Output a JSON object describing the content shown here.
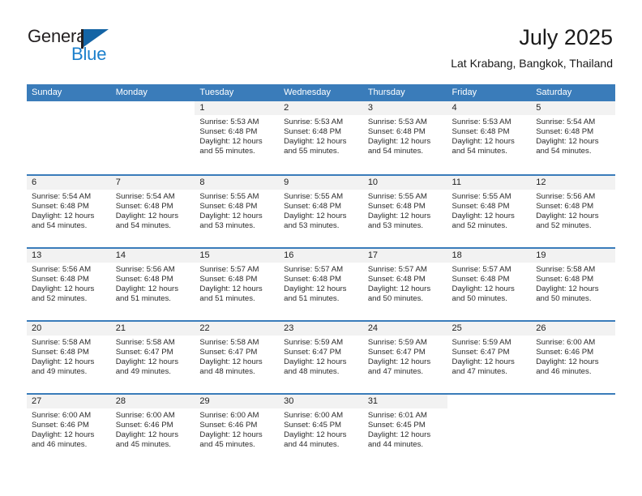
{
  "brand": {
    "name_top": "General",
    "name_bottom": "Blue",
    "flag_icon": "blue-triangle-flag-icon",
    "color_dark": "#231f20",
    "color_blue": "#1b7fcc"
  },
  "header": {
    "title": "July 2025",
    "subtitle": "Lat Krabang, Bangkok, Thailand"
  },
  "theme": {
    "header_blue": "#3a7cba",
    "row_divider_blue": "#3a7cba",
    "daynum_band_gray": "#f2f2f2",
    "text_dark": "#2b2b2b"
  },
  "weekdays": [
    "Sunday",
    "Monday",
    "Tuesday",
    "Wednesday",
    "Thursday",
    "Friday",
    "Saturday"
  ],
  "weeks": [
    [
      {
        "day": "",
        "lines": []
      },
      {
        "day": "",
        "lines": []
      },
      {
        "day": "1",
        "lines": [
          "Sunrise: 5:53 AM",
          "Sunset: 6:48 PM",
          "Daylight: 12 hours",
          "and 55 minutes."
        ]
      },
      {
        "day": "2",
        "lines": [
          "Sunrise: 5:53 AM",
          "Sunset: 6:48 PM",
          "Daylight: 12 hours",
          "and 55 minutes."
        ]
      },
      {
        "day": "3",
        "lines": [
          "Sunrise: 5:53 AM",
          "Sunset: 6:48 PM",
          "Daylight: 12 hours",
          "and 54 minutes."
        ]
      },
      {
        "day": "4",
        "lines": [
          "Sunrise: 5:53 AM",
          "Sunset: 6:48 PM",
          "Daylight: 12 hours",
          "and 54 minutes."
        ]
      },
      {
        "day": "5",
        "lines": [
          "Sunrise: 5:54 AM",
          "Sunset: 6:48 PM",
          "Daylight: 12 hours",
          "and 54 minutes."
        ]
      }
    ],
    [
      {
        "day": "6",
        "lines": [
          "Sunrise: 5:54 AM",
          "Sunset: 6:48 PM",
          "Daylight: 12 hours",
          "and 54 minutes."
        ]
      },
      {
        "day": "7",
        "lines": [
          "Sunrise: 5:54 AM",
          "Sunset: 6:48 PM",
          "Daylight: 12 hours",
          "and 54 minutes."
        ]
      },
      {
        "day": "8",
        "lines": [
          "Sunrise: 5:55 AM",
          "Sunset: 6:48 PM",
          "Daylight: 12 hours",
          "and 53 minutes."
        ]
      },
      {
        "day": "9",
        "lines": [
          "Sunrise: 5:55 AM",
          "Sunset: 6:48 PM",
          "Daylight: 12 hours",
          "and 53 minutes."
        ]
      },
      {
        "day": "10",
        "lines": [
          "Sunrise: 5:55 AM",
          "Sunset: 6:48 PM",
          "Daylight: 12 hours",
          "and 53 minutes."
        ]
      },
      {
        "day": "11",
        "lines": [
          "Sunrise: 5:55 AM",
          "Sunset: 6:48 PM",
          "Daylight: 12 hours",
          "and 52 minutes."
        ]
      },
      {
        "day": "12",
        "lines": [
          "Sunrise: 5:56 AM",
          "Sunset: 6:48 PM",
          "Daylight: 12 hours",
          "and 52 minutes."
        ]
      }
    ],
    [
      {
        "day": "13",
        "lines": [
          "Sunrise: 5:56 AM",
          "Sunset: 6:48 PM",
          "Daylight: 12 hours",
          "and 52 minutes."
        ]
      },
      {
        "day": "14",
        "lines": [
          "Sunrise: 5:56 AM",
          "Sunset: 6:48 PM",
          "Daylight: 12 hours",
          "and 51 minutes."
        ]
      },
      {
        "day": "15",
        "lines": [
          "Sunrise: 5:57 AM",
          "Sunset: 6:48 PM",
          "Daylight: 12 hours",
          "and 51 minutes."
        ]
      },
      {
        "day": "16",
        "lines": [
          "Sunrise: 5:57 AM",
          "Sunset: 6:48 PM",
          "Daylight: 12 hours",
          "and 51 minutes."
        ]
      },
      {
        "day": "17",
        "lines": [
          "Sunrise: 5:57 AM",
          "Sunset: 6:48 PM",
          "Daylight: 12 hours",
          "and 50 minutes."
        ]
      },
      {
        "day": "18",
        "lines": [
          "Sunrise: 5:57 AM",
          "Sunset: 6:48 PM",
          "Daylight: 12 hours",
          "and 50 minutes."
        ]
      },
      {
        "day": "19",
        "lines": [
          "Sunrise: 5:58 AM",
          "Sunset: 6:48 PM",
          "Daylight: 12 hours",
          "and 50 minutes."
        ]
      }
    ],
    [
      {
        "day": "20",
        "lines": [
          "Sunrise: 5:58 AM",
          "Sunset: 6:48 PM",
          "Daylight: 12 hours",
          "and 49 minutes."
        ]
      },
      {
        "day": "21",
        "lines": [
          "Sunrise: 5:58 AM",
          "Sunset: 6:47 PM",
          "Daylight: 12 hours",
          "and 49 minutes."
        ]
      },
      {
        "day": "22",
        "lines": [
          "Sunrise: 5:58 AM",
          "Sunset: 6:47 PM",
          "Daylight: 12 hours",
          "and 48 minutes."
        ]
      },
      {
        "day": "23",
        "lines": [
          "Sunrise: 5:59 AM",
          "Sunset: 6:47 PM",
          "Daylight: 12 hours",
          "and 48 minutes."
        ]
      },
      {
        "day": "24",
        "lines": [
          "Sunrise: 5:59 AM",
          "Sunset: 6:47 PM",
          "Daylight: 12 hours",
          "and 47 minutes."
        ]
      },
      {
        "day": "25",
        "lines": [
          "Sunrise: 5:59 AM",
          "Sunset: 6:47 PM",
          "Daylight: 12 hours",
          "and 47 minutes."
        ]
      },
      {
        "day": "26",
        "lines": [
          "Sunrise: 6:00 AM",
          "Sunset: 6:46 PM",
          "Daylight: 12 hours",
          "and 46 minutes."
        ]
      }
    ],
    [
      {
        "day": "27",
        "lines": [
          "Sunrise: 6:00 AM",
          "Sunset: 6:46 PM",
          "Daylight: 12 hours",
          "and 46 minutes."
        ]
      },
      {
        "day": "28",
        "lines": [
          "Sunrise: 6:00 AM",
          "Sunset: 6:46 PM",
          "Daylight: 12 hours",
          "and 45 minutes."
        ]
      },
      {
        "day": "29",
        "lines": [
          "Sunrise: 6:00 AM",
          "Sunset: 6:46 PM",
          "Daylight: 12 hours",
          "and 45 minutes."
        ]
      },
      {
        "day": "30",
        "lines": [
          "Sunrise: 6:00 AM",
          "Sunset: 6:45 PM",
          "Daylight: 12 hours",
          "and 44 minutes."
        ]
      },
      {
        "day": "31",
        "lines": [
          "Sunrise: 6:01 AM",
          "Sunset: 6:45 PM",
          "Daylight: 12 hours",
          "and 44 minutes."
        ]
      },
      {
        "day": "",
        "lines": []
      },
      {
        "day": "",
        "lines": []
      }
    ]
  ]
}
